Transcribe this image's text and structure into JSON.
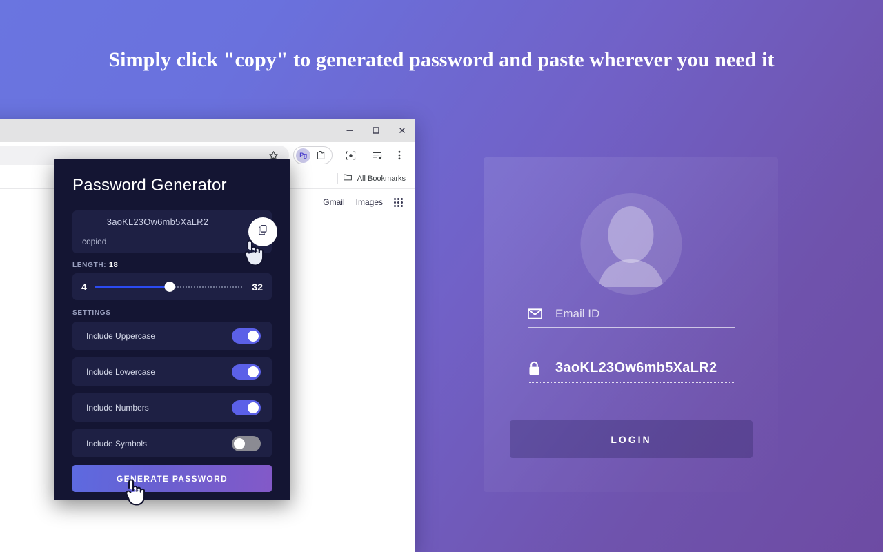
{
  "headline": "Simply click \"copy\" to generated password and paste wherever you need it",
  "theme": {
    "bg_start": "#6a75e0",
    "bg_end": "#6d4ba3",
    "popup_bg": "#141533",
    "popup_panel": "#1e2044",
    "toggle_on": "#5b60e8",
    "toggle_off": "#8b8b93",
    "slider_fill": "#2b4bf2"
  },
  "browser": {
    "window_controls": [
      {
        "name": "minimize",
        "glyph": "minimize-icon"
      },
      {
        "name": "maximize",
        "glyph": "maximize-icon"
      },
      {
        "name": "close",
        "glyph": "close-icon"
      }
    ],
    "toolbar": {
      "bookmark_star": "star-icon",
      "extension_chip_label": "Pg",
      "extensions_puzzle": "puzzle-icon",
      "lens": "lens-icon",
      "media": "media-control-icon",
      "menu": "three-dot-menu-icon"
    },
    "bookmarks": {
      "all_bookmarks_label": "All Bookmarks",
      "folder_icon": "folder-icon"
    },
    "page_links": [
      {
        "label": "Gmail"
      },
      {
        "label": "Images"
      }
    ],
    "apps_grid_icon": "apps-grid-icon"
  },
  "popup": {
    "title": "Password Generator",
    "password_value": "3aoKL23Ow6mb5XaLR2",
    "copied_status": "copied",
    "copy_icon": "copy-icon",
    "length": {
      "label": "LENGTH:",
      "value": "18",
      "min": "4",
      "max": "32",
      "fill_percent": 50
    },
    "settings_label": "SETTINGS",
    "options": [
      {
        "label": "Include Uppercase",
        "state": "on"
      },
      {
        "label": "Include Lowercase",
        "state": "on"
      },
      {
        "label": "Include Numbers",
        "state": "on"
      },
      {
        "label": "Include Symbols",
        "state": "off"
      }
    ],
    "generate_label": "GENERATE PASSWORD"
  },
  "login_card": {
    "avatar_icon": "user-avatar-icon",
    "email": {
      "icon": "envelope-icon",
      "placeholder": "Email ID",
      "value": ""
    },
    "password": {
      "icon": "lock-icon",
      "value": "3aoKL23Ow6mb5XaLR2"
    },
    "login_label": "LOGIN"
  },
  "cursors": [
    {
      "name": "pointer-over-copy-button"
    },
    {
      "name": "pointer-over-generate-button"
    }
  ]
}
